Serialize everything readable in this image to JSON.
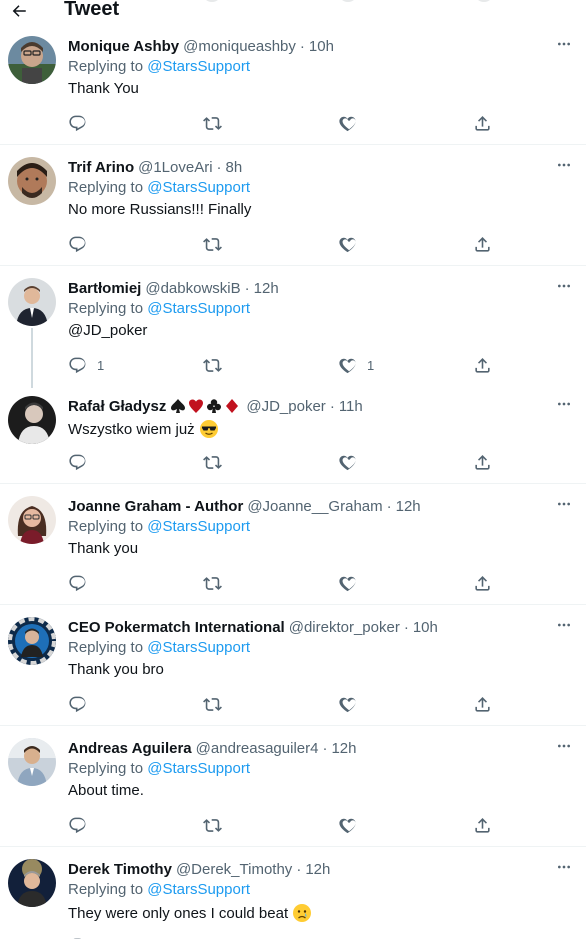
{
  "header": {
    "title": "Tweet",
    "back_icon": "arrow-left-icon"
  },
  "colors": {
    "link": "#1d9bf0",
    "secondary": "#536471",
    "primary": "#0f1419",
    "divider": "#eff3f4"
  },
  "replying_prefix": "Replying to",
  "dot": "·",
  "tweets": [
    {
      "name": "Monique Ashby",
      "handle": "@moniqueashby",
      "time": "10h",
      "replying_to": "@StarsSupport",
      "text": "Thank You",
      "reply_count": "",
      "like_count": ""
    },
    {
      "name": "Trif Arino",
      "handle": "@1LoveAri",
      "time": "8h",
      "replying_to": "@StarsSupport",
      "text": "No more Russians!!! Finally",
      "reply_count": "",
      "like_count": ""
    },
    {
      "name": "Bartłomiej",
      "handle": "@dabkowskiB",
      "time": "12h",
      "replying_to": "@StarsSupport",
      "text": "@JD_poker",
      "reply_count": "1",
      "like_count": "1"
    },
    {
      "name": "Rafał Gładysz",
      "handle": "@JD_poker",
      "time": "11h",
      "text": "Wszystko wiem już",
      "name_icons": [
        "spade-icon",
        "heart-suit-icon",
        "club-icon",
        "diamond-icon"
      ],
      "text_emoji": "sunglasses-emoji"
    },
    {
      "name": "Joanne Graham - Author",
      "handle": "@Joanne__Graham",
      "time": "12h",
      "replying_to": "@StarsSupport",
      "text": "Thank you"
    },
    {
      "name": "CEO Pokermatch International",
      "handle": "@direktor_poker",
      "time": "10h",
      "replying_to": "@StarsSupport",
      "text": "Thank you bro"
    },
    {
      "name": "Andreas Aguilera",
      "handle": "@andreasaguiler4",
      "time": "12h",
      "replying_to": "@StarsSupport",
      "text": "About time."
    },
    {
      "name": "Derek Timothy",
      "handle": "@Derek_Timothy",
      "time": "12h",
      "replying_to": "@StarsSupport",
      "text": "They were only ones I could beat",
      "text_emoji": "crying-face-emoji"
    }
  ]
}
